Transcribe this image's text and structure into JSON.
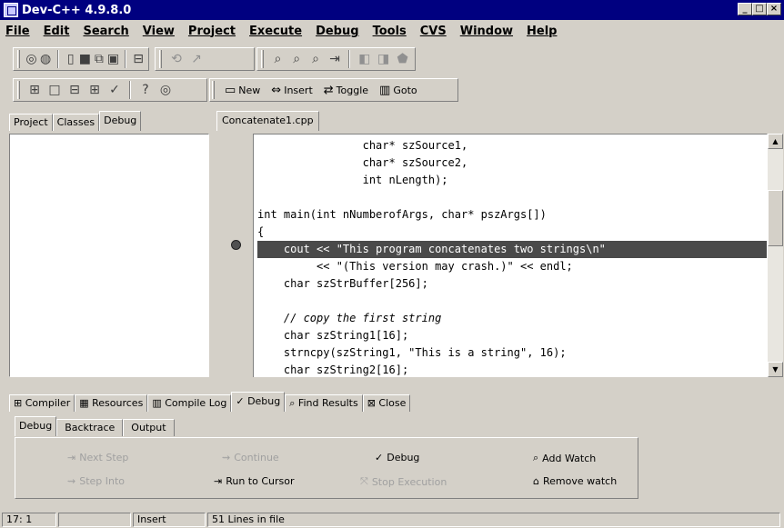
{
  "window": {
    "title": "Dev-C++ 4.9.8.0"
  },
  "menu": [
    "File",
    "Edit",
    "Search",
    "View",
    "Project",
    "Execute",
    "Debug",
    "Tools",
    "CVS",
    "Window",
    "Help"
  ],
  "toolbar3": {
    "new": "New",
    "insert": "Insert",
    "toggle": "Toggle",
    "goto": "Goto"
  },
  "left_tabs": [
    "Project",
    "Classes",
    "Debug"
  ],
  "editor_tab": "Concatenate1.cpp",
  "code_lines": [
    "                char* szSource1,",
    "                char* szSource2,",
    "                int nLength);",
    "",
    "int main(int nNumberofArgs, char* pszArgs[])",
    "{",
    "    cout << \"This program concatenates two strings\\n\"",
    "         << \"(This version may crash.)\" << endl;",
    "    char szStrBuffer[256];",
    "",
    "    // copy the first string",
    "    char szString1[16];",
    "    strncpy(szString1, \"This is a string\", 16);",
    "    char szString2[16];"
  ],
  "selected_line_index": 6,
  "bottom_tabs": [
    "Compiler",
    "Resources",
    "Compile Log",
    "Debug",
    "Find Results",
    "Close"
  ],
  "debug_subtabs": [
    "Debug",
    "Backtrace",
    "Output"
  ],
  "debug_buttons": {
    "next_step": "Next Step",
    "step_into": "Step Into",
    "continue": "Continue",
    "run_to_cursor": "Run to Cursor",
    "debug": "Debug",
    "stop_execution": "Stop Execution",
    "add_watch": "Add Watch",
    "remove_watch": "Remove watch"
  },
  "status": {
    "position": "17: 1",
    "modified": "",
    "mode": "Insert",
    "lines": "51 Lines in file"
  },
  "colors": {
    "titlebar": "#000080",
    "selection": "#4a4a4a",
    "face": "#d4d0c8"
  }
}
